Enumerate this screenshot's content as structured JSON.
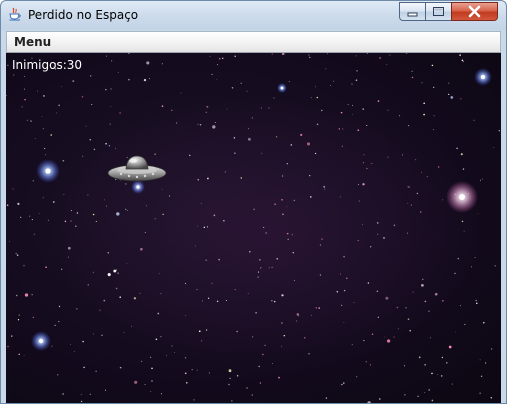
{
  "window": {
    "title": "Perdido no Espaço"
  },
  "menu": {
    "items": [
      {
        "label": "Menu"
      }
    ]
  },
  "hud": {
    "enemies_label": "Inimigos",
    "enemies_count": "30"
  },
  "icons": {
    "app": "java-cup-icon",
    "minimize": "minimize-icon",
    "maximize": "maximize-icon",
    "close": "close-icon",
    "enemy": "ufo-sprite"
  },
  "colors": {
    "space_background": "#140b1e",
    "hud_text": "#ffffff",
    "close_button": "#c94a31"
  }
}
